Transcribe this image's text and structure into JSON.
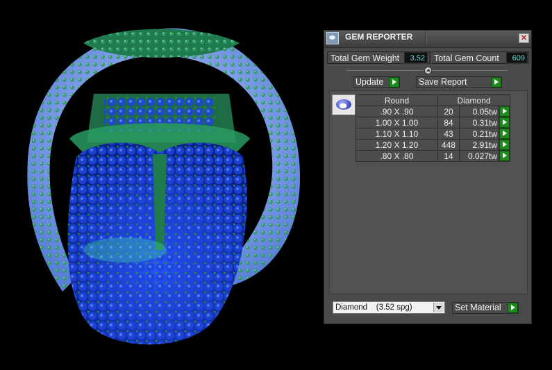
{
  "panel": {
    "title": "GEM REPORTER",
    "close_glyph": "✕",
    "total_weight_label": "Total Gem Weight",
    "total_weight_value": "3.52",
    "total_count_label": "Total Gem Count",
    "total_count_value": "609",
    "update_label": "Update",
    "save_report_label": "Save Report",
    "table": {
      "headers": [
        "Round",
        "Diamond"
      ],
      "rows": [
        {
          "size": ".90 X .90",
          "count": "20",
          "weight": "0.05tw"
        },
        {
          "size": "1.00 X 1.00",
          "count": "84",
          "weight": "0.31tw"
        },
        {
          "size": "1.10 X 1.10",
          "count": "43",
          "weight": "0.21tw"
        },
        {
          "size": "1.20 X 1.20",
          "count": "448",
          "weight": "2.91tw"
        },
        {
          "size": ".80 X .80",
          "count": "14",
          "weight": "0.027tw"
        }
      ]
    },
    "material_select_value": "Diamond    (3.52 spg)",
    "set_material_label": "Set Material"
  },
  "icons": {
    "app": "gem-reporter-app-icon",
    "close": "close-icon",
    "play": "green-arrow-icon",
    "thumb": "gem-stone-icon"
  },
  "colors": {
    "panel_bg": "#4a4a4a",
    "value_text": "#74d6d6",
    "action_green": "#1e8a1e",
    "model_green": "#1f7a4e",
    "model_blue": "#1a3fd0",
    "model_light_blue": "#8fb0ff"
  }
}
